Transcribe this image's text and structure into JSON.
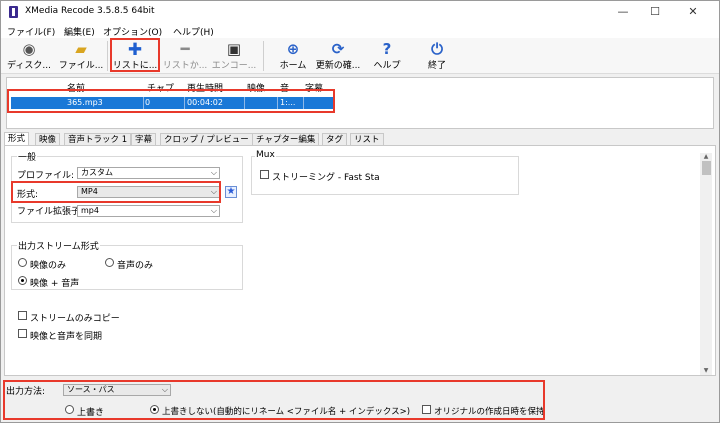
{
  "window": {
    "title": "XMedia Recode 3.5.8.5 64bit",
    "minimize": "—",
    "maximize": "☐",
    "close": "✕"
  },
  "menu": [
    "ファイル(F)",
    "編集(E)",
    "オプション(O)",
    "ヘルプ(H)"
  ],
  "toolbar": {
    "disc": "ディスク...",
    "file": "ファイル...",
    "add_list": "リストに...",
    "remove_list": "リストか...",
    "encode": "エンコー...",
    "home": "ホーム",
    "update": "更新の確...",
    "help": "ヘルプ",
    "exit": "終了"
  },
  "list": {
    "columns": [
      "名前",
      "チャプ...",
      "再生時間",
      "映像",
      "音...",
      "字幕"
    ],
    "rows": [
      {
        "name": "365.mp3",
        "chapter": "0",
        "duration": "00:04:02",
        "video": "",
        "audio": "1:..."
      }
    ]
  },
  "tabs": [
    "形式",
    "映像",
    "音声トラック 1",
    "字幕",
    "クロップ / プレビュー",
    "チャプター編集",
    "タグ",
    "リスト"
  ],
  "general": {
    "title": "一般",
    "profile_label": "プロファイル:",
    "profile_value": "カスタム",
    "format_label": "形式:",
    "format_value": "MP4",
    "ext_label": "ファイル拡張子:",
    "ext_value": "mp4"
  },
  "mux": {
    "title": "Mux",
    "streaming": "ストリーミング - Fast Sta"
  },
  "output_stream": {
    "title": "出力ストリーム形式",
    "video_only": "映像のみ",
    "audio_only": "音声のみ",
    "video_audio": "映像 + 音声"
  },
  "options": {
    "stream_copy": "ストリームのみコピー",
    "sync": "映像と音声を同期"
  },
  "output": {
    "label": "出力方法:",
    "method": "ソース・パス",
    "overwrite": "上書き",
    "no_overwrite": "上書きしない(自動的にリネーム <ファイル名 + インデックス>)",
    "keep_date": "オリジナルの作成日時を保持"
  },
  "colors": {
    "highlight": "#e8392b",
    "selection": "#1a78d7",
    "add_icon": "#1f5fd0"
  }
}
